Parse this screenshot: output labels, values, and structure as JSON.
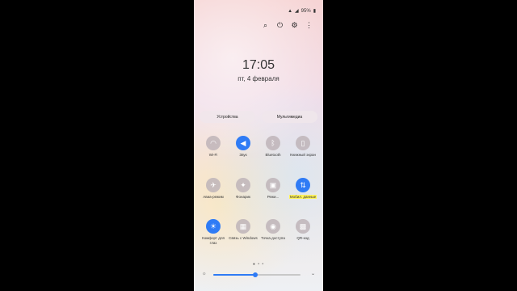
{
  "status": {
    "battery": "95%"
  },
  "header": {
    "time": "17:05",
    "date": "пт, 4 февраля"
  },
  "tabs": [
    "Устройства",
    "Мультимедиа"
  ],
  "tiles": [
    {
      "label": "Wi-Fi",
      "icon": "wifi-icon",
      "on": false
    },
    {
      "label": "Звук",
      "icon": "speaker-icon",
      "on": true
    },
    {
      "label": "Bluetooth",
      "icon": "bluetooth-icon",
      "on": false
    },
    {
      "label": "Книжный экран",
      "icon": "portrait-lock-icon",
      "on": false
    },
    {
      "label": "Авиа-режим",
      "icon": "airplane-icon",
      "on": false
    },
    {
      "label": "Фонарик",
      "icon": "flashlight-icon",
      "on": false
    },
    {
      "label": "Режи...",
      "icon": "power-saving-icon",
      "on": false
    },
    {
      "label": "Мобил. данные",
      "icon": "mobile-data-icon",
      "on": true
    },
    {
      "label": "Комфорт для глаз",
      "icon": "eye-comfort-icon",
      "on": true
    },
    {
      "label": "Связь с Windows",
      "icon": "link-windows-icon",
      "on": false
    },
    {
      "label": "Точка доступа",
      "icon": "hotspot-icon",
      "on": false
    },
    {
      "label": "QR-код",
      "icon": "qr-icon",
      "on": false
    }
  ],
  "brightness": {
    "level": 0.48
  },
  "colors": {
    "accent": "#2f7bf5",
    "highlight": "#fff35c"
  }
}
